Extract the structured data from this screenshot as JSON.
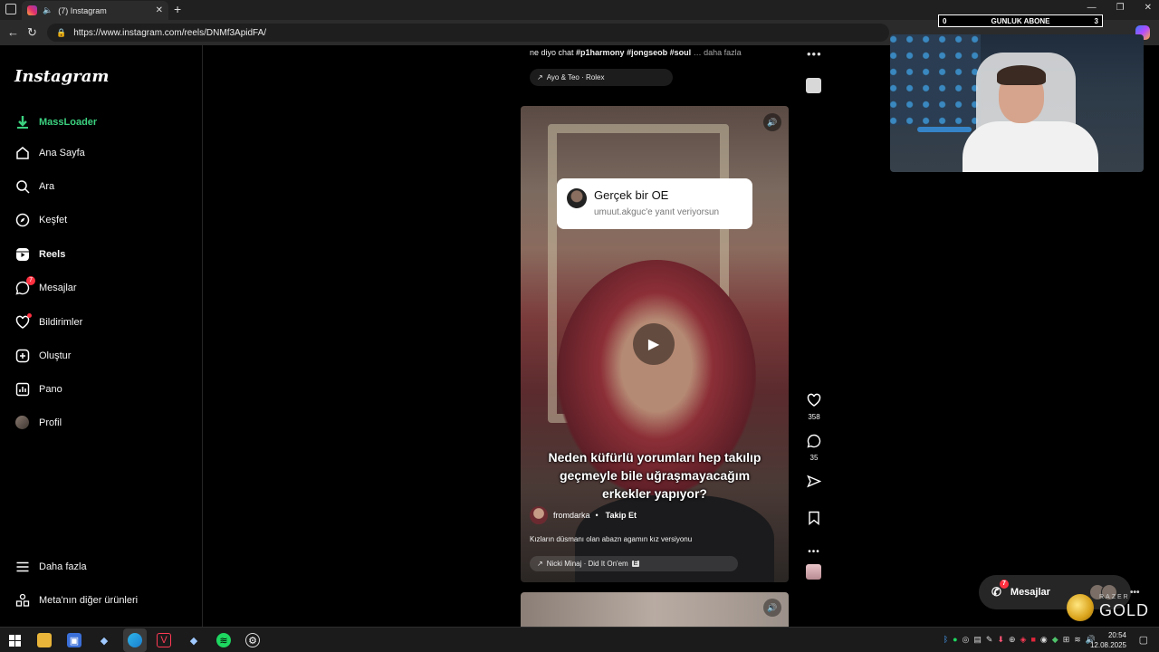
{
  "browser": {
    "tab_title": "(7) Instagram",
    "url": "https://www.instagram.com/reels/DNMf3ApidFA/"
  },
  "sidebar": {
    "logo": "Instagram",
    "items": [
      {
        "label": "MassLoader",
        "icon": "download-icon"
      },
      {
        "label": "Ana Sayfa",
        "icon": "home-icon"
      },
      {
        "label": "Ara",
        "icon": "search-icon"
      },
      {
        "label": "Keşfet",
        "icon": "compass-icon"
      },
      {
        "label": "Reels",
        "icon": "reels-icon"
      },
      {
        "label": "Mesajlar",
        "icon": "messenger-icon",
        "badge": "7"
      },
      {
        "label": "Bildirimler",
        "icon": "heart-icon"
      },
      {
        "label": "Oluştur",
        "icon": "plus-square-icon"
      },
      {
        "label": "Pano",
        "icon": "dashboard-icon"
      },
      {
        "label": "Profil",
        "icon": "avatar"
      }
    ],
    "bottom": [
      {
        "label": "Daha fazla",
        "icon": "menu-icon"
      },
      {
        "label": "Meta'nın diğer ürünleri",
        "icon": "meta-apps-icon"
      }
    ]
  },
  "prev_post": {
    "caption_prefix": "ne diyo chat ",
    "caption_tags": "#p1harmony #jongseob #soul",
    "caption_more": "… daha fazla",
    "music": "Ayo & Teo · Rolex"
  },
  "reel": {
    "reply_title": "Gerçek bir OE",
    "reply_sub": "umuut.akguc'e yanıt veriyorsun",
    "overlay_text": "Neden küfürlü yorumları hep takılıp geçmeyle bile uğraşmayacağım erkekler yapıyor?",
    "author": "fromdarka",
    "follow": "Takip Et",
    "caption": "Kızların düsmanı olan abazn agamın kız versiyonu",
    "music": "Nicki Minaj · Did It On'em",
    "likes": "358",
    "comments": "35"
  },
  "dm_pill": {
    "label": "Mesajlar",
    "badge": "7"
  },
  "overlay": {
    "sub_left": "0",
    "sub_title": "GUNLUK ABONE",
    "sub_right": "3",
    "razer_top": "RAZER",
    "razer_gold": "GOLD"
  },
  "taskbar": {
    "time": "20:54",
    "date": "12.08.2025"
  }
}
